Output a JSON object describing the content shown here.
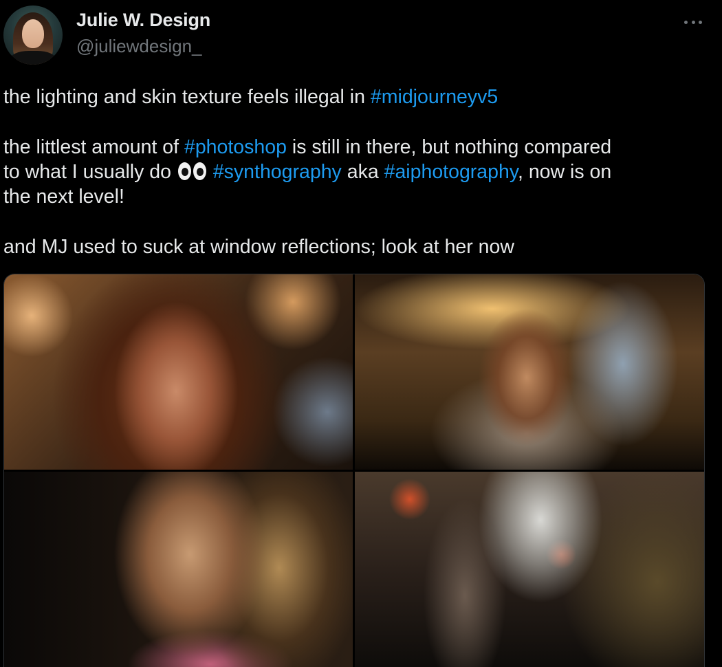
{
  "author": {
    "display_name": "Julie W. Design",
    "handle": "@juliewdesign_"
  },
  "tweet": {
    "line1": {
      "text": "the lighting and skin texture feels illegal in ",
      "tag": "#midjourneyv5"
    },
    "para2": {
      "pre": "the littlest amount of ",
      "tag_photoshop": "#photoshop",
      "mid1": " is still in there, but nothing compared",
      "line2_pre": "to what I usually do ",
      "emoji": "eyes",
      "tag_synth": "#synthography",
      "mid2": " aka ",
      "tag_ai": "#aiphotography",
      "line2_post": ", now is on",
      "line3": "the next level!"
    },
    "para3": "and MJ used to suck at window reflections; look at her now"
  },
  "media": {
    "count": 4,
    "photos": [
      {
        "icon": "photo-portrait-curly-hair"
      },
      {
        "icon": "photo-window-reflection-bakery"
      },
      {
        "icon": "photo-portrait-closeup"
      },
      {
        "icon": "photo-florist-at-work"
      }
    ]
  },
  "colors": {
    "background": "#000000",
    "text": "#e7e9ea",
    "secondary": "#71767b",
    "link": "#1d9bf0"
  },
  "icons": {
    "more": "more-horizontal-icon",
    "emoji": "eyes-emoji-icon"
  }
}
